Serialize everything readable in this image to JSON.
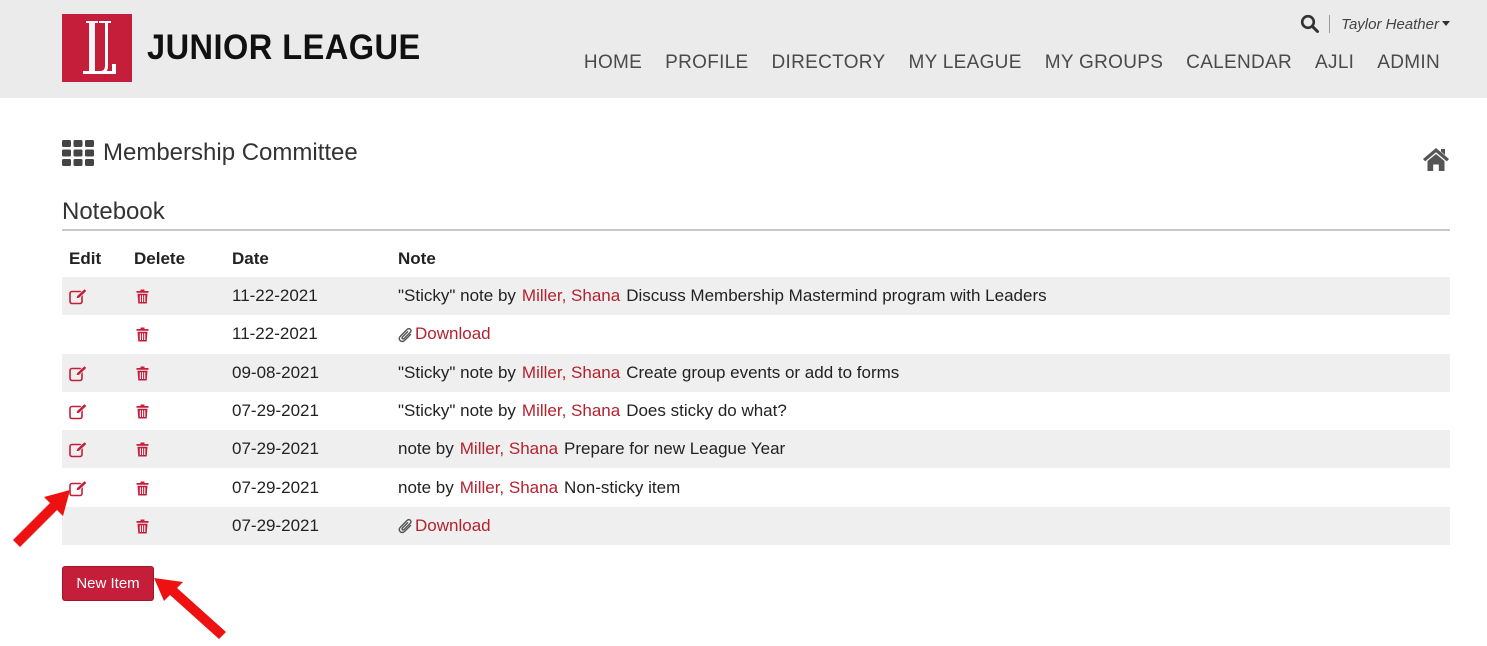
{
  "brand": {
    "name": "JUNIOR LEAGUE",
    "color": "#c41e3a"
  },
  "util": {
    "user_name": "Taylor Heather"
  },
  "nav": {
    "items": [
      "HOME",
      "PROFILE",
      "DIRECTORY",
      "MY LEAGUE",
      "MY GROUPS",
      "CALENDAR",
      "AJLI",
      "ADMIN"
    ]
  },
  "page": {
    "title": "Membership Committee",
    "section": "Notebook"
  },
  "table": {
    "headers": {
      "edit": "Edit",
      "delete": "Delete",
      "date": "Date",
      "note": "Note"
    },
    "rows": [
      {
        "editable": true,
        "date": "11-22-2021",
        "type": "note",
        "prefix": "\"Sticky\" note by",
        "author": "Miller, Shana",
        "text": "Discuss Membership Mastermind program with Leaders"
      },
      {
        "editable": false,
        "date": "11-22-2021",
        "type": "file",
        "link": "Download"
      },
      {
        "editable": true,
        "date": "09-08-2021",
        "type": "note",
        "prefix": "\"Sticky\" note by",
        "author": "Miller, Shana",
        "text": "Create group events or add to forms"
      },
      {
        "editable": true,
        "date": "07-29-2021",
        "type": "note",
        "prefix": "\"Sticky\" note by",
        "author": "Miller, Shana",
        "text": "Does sticky do what?"
      },
      {
        "editable": true,
        "date": "07-29-2021",
        "type": "note",
        "prefix": "note by",
        "author": "Miller, Shana",
        "text": "Prepare for new League Year"
      },
      {
        "editable": true,
        "date": "07-29-2021",
        "type": "note",
        "prefix": "note by",
        "author": "Miller, Shana",
        "text": "Non-sticky item"
      },
      {
        "editable": false,
        "date": "07-29-2021",
        "type": "file",
        "link": "Download"
      }
    ]
  },
  "actions": {
    "new_item": "New Item"
  },
  "icons": {
    "search": "search-icon",
    "grid": "grid-icon",
    "home": "home-icon",
    "edit": "edit-icon",
    "delete": "trash-icon",
    "attachment": "paperclip-icon"
  },
  "colors": {
    "accent": "#c41e3a",
    "link": "#b5222f",
    "annotation_arrow": "#ee1111"
  }
}
